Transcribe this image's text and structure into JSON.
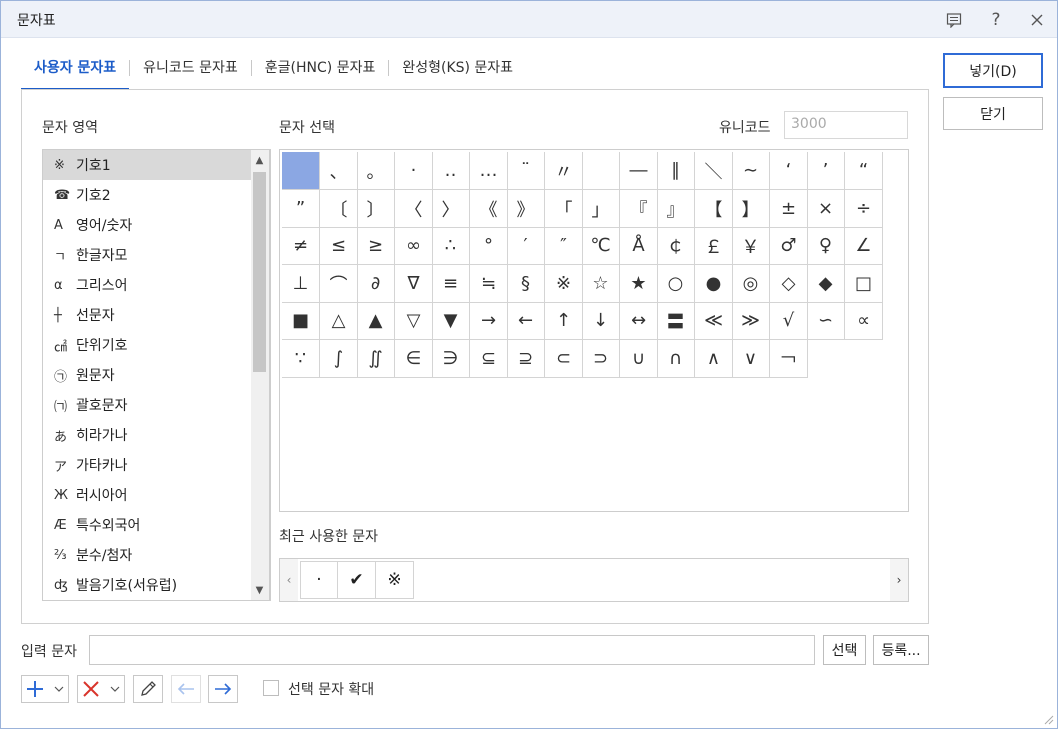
{
  "window": {
    "title": "문자표",
    "icons": [
      "comment-icon",
      "help-icon",
      "close-icon"
    ]
  },
  "tabs": [
    {
      "label": "사용자 문자표",
      "active": true
    },
    {
      "label": "유니코드 문자표",
      "active": false
    },
    {
      "label": "훈글(HNC) 문자표",
      "active": false
    },
    {
      "label": "완성형(KS) 문자표",
      "active": false
    }
  ],
  "panel": {
    "area_label": "문자 영역",
    "select_label": "문자 선택",
    "unicode_label": "유니코드",
    "unicode_placeholder": "3000",
    "recent_label": "최근 사용한 문자"
  },
  "areas": [
    {
      "icon": "※",
      "label": "기호1",
      "selected": true
    },
    {
      "icon": "☎",
      "label": "기호2"
    },
    {
      "icon": "A",
      "label": "영어/숫자"
    },
    {
      "icon": "ㄱ",
      "label": "한글자모"
    },
    {
      "icon": "α",
      "label": "그리스어"
    },
    {
      "icon": "┼",
      "label": "선문자"
    },
    {
      "icon": "㎠",
      "label": "단위기호"
    },
    {
      "icon": "㉠",
      "label": "원문자"
    },
    {
      "icon": "㈀",
      "label": "괄호문자"
    },
    {
      "icon": "あ",
      "label": "히라가나"
    },
    {
      "icon": "ア",
      "label": "가타카나"
    },
    {
      "icon": "Ж",
      "label": "러시아어"
    },
    {
      "icon": "Æ",
      "label": "특수외국어"
    },
    {
      "icon": "⅔",
      "label": "분수/첨자"
    },
    {
      "icon": "ʤ",
      "label": "발음기호(서유럽)"
    }
  ],
  "chars": [
    " ",
    "、",
    "。",
    "·",
    "‥",
    "…",
    "¨",
    "〃",
    "­",
    "―",
    "∥",
    "＼",
    "∼",
    "‘",
    "’",
    "“",
    "”",
    "〔",
    "〕",
    "〈",
    "〉",
    "《",
    "》",
    "「",
    "」",
    "『",
    "』",
    "【",
    "】",
    "±",
    "×",
    "÷",
    "≠",
    "≤",
    "≥",
    "∞",
    "∴",
    "°",
    "′",
    "″",
    "℃",
    "Å",
    "￠",
    "￡",
    "￥",
    "♂",
    "♀",
    "∠",
    "⊥",
    "⌒",
    "∂",
    "∇",
    "≡",
    "≒",
    "§",
    "※",
    "☆",
    "★",
    "○",
    "●",
    "◎",
    "◇",
    "◆",
    "□",
    "■",
    "△",
    "▲",
    "▽",
    "▼",
    "→",
    "←",
    "↑",
    "↓",
    "↔",
    "〓",
    "≪",
    "≫",
    "√",
    "∽",
    "∝",
    "∵",
    "∫",
    "∬",
    "∈",
    "∋",
    "⊆",
    "⊇",
    "⊂",
    "⊃",
    "∪",
    "∩",
    "∧",
    "∨",
    "￢"
  ],
  "recent": [
    "·",
    "✔",
    "※"
  ],
  "buttons": {
    "insert": "넣기(D)",
    "close": "닫기",
    "select": "선택",
    "register": "등록..."
  },
  "input": {
    "label": "입력 문자",
    "value": ""
  },
  "checkbox": {
    "label": "선택 문자 확대",
    "checked": false
  },
  "colors": {
    "accent": "#1c5cc8",
    "selected_cell": "#8ba7e3",
    "tool_add": "#2f6bd6",
    "tool_delete": "#d9342b"
  }
}
